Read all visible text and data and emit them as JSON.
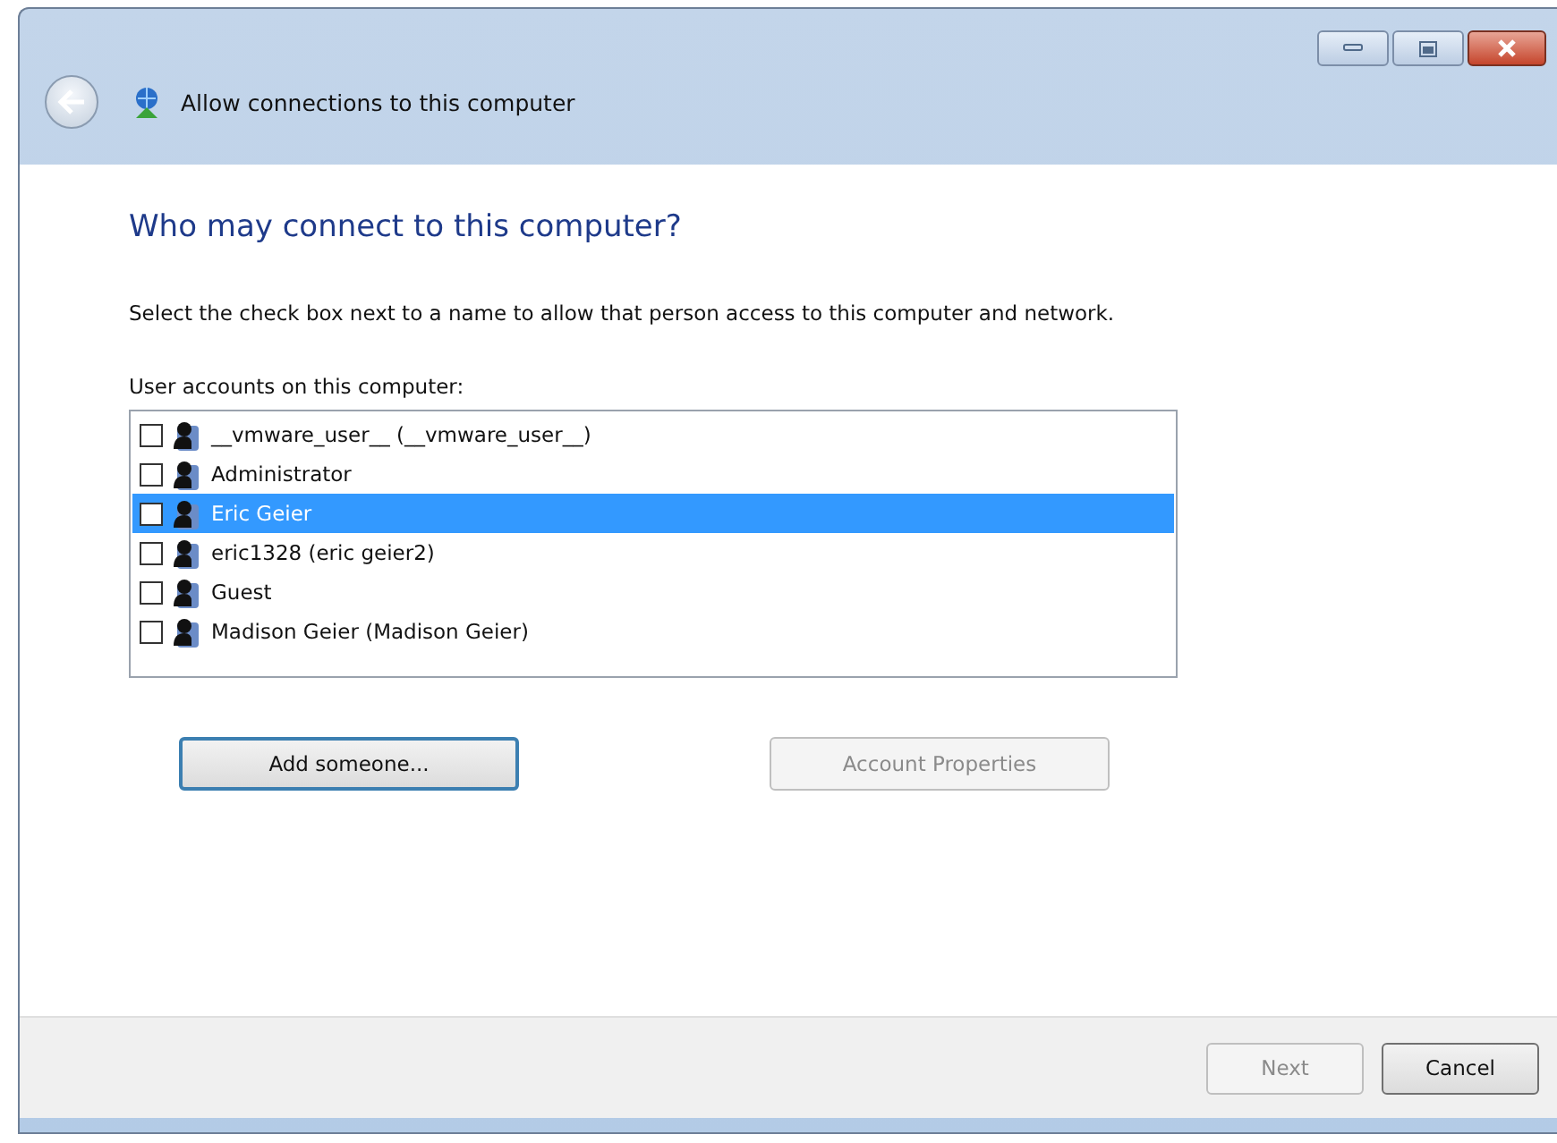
{
  "window": {
    "title": "Allow connections to this computer"
  },
  "heading": "Who may connect to this computer?",
  "description": "Select the check box next to a name to allow that person access to this computer and network.",
  "list_label": "User accounts on this computer:",
  "accounts": [
    {
      "name": "__vmware_user__ (__vmware_user__)",
      "checked": false,
      "selected": false
    },
    {
      "name": "Administrator",
      "checked": false,
      "selected": false
    },
    {
      "name": "Eric Geier",
      "checked": false,
      "selected": true
    },
    {
      "name": "eric1328 (eric geier2)",
      "checked": false,
      "selected": false
    },
    {
      "name": "Guest",
      "checked": false,
      "selected": false
    },
    {
      "name": "Madison Geier (Madison Geier)",
      "checked": false,
      "selected": false
    }
  ],
  "list_buttons": [
    {
      "label": "Add someone...",
      "disabled": false,
      "focused": true
    },
    {
      "label": "Account Properties",
      "disabled": true,
      "focused": false
    }
  ],
  "footer_buttons": [
    {
      "label": "Next",
      "disabled": true,
      "focused": false
    },
    {
      "label": "Cancel",
      "disabled": false,
      "focused": false
    }
  ]
}
